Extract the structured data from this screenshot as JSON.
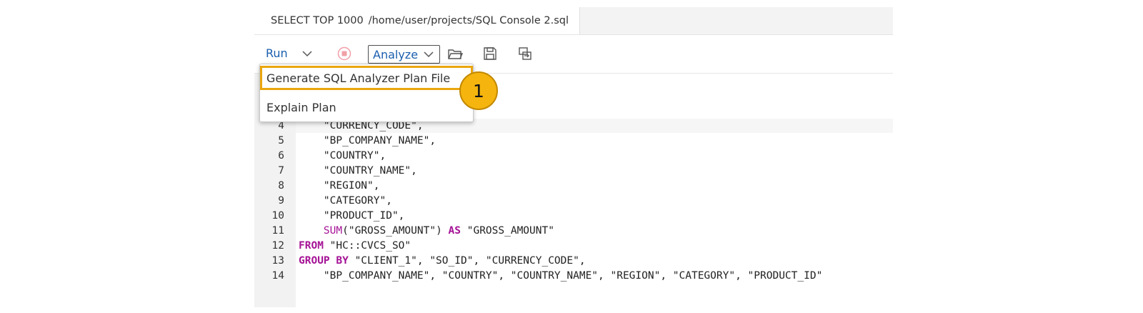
{
  "tab": {
    "title": "SELECT TOP 1000",
    "path": "/home/user/projects/SQL Console 2.sql",
    "icon": "database-icon",
    "unsaved_indicator": "dot"
  },
  "toolbar": {
    "run_label": "Run",
    "analyze_label": "Analyze",
    "icons": [
      "chevron-down-icon",
      "stop-icon",
      "folder-open-icon",
      "save-icon",
      "export-icon"
    ]
  },
  "dropdown": {
    "items": [
      {
        "label": "Generate SQL Analyzer Plan File"
      },
      {
        "label": "Explain Plan"
      }
    ]
  },
  "callout": {
    "label": "1"
  },
  "editor": {
    "lines": [
      {
        "num": "4",
        "text": "    \"CURRENCY_CODE\","
      },
      {
        "num": "5",
        "text": "    \"BP_COMPANY_NAME\","
      },
      {
        "num": "6",
        "text": "    \"COUNTRY\","
      },
      {
        "num": "7",
        "text": "    \"COUNTRY_NAME\","
      },
      {
        "num": "8",
        "text": "    \"REGION\","
      },
      {
        "num": "9",
        "text": "    \"CATEGORY\","
      },
      {
        "num": "10",
        "text": "    \"PRODUCT_ID\","
      },
      {
        "num": "11",
        "indent": "    ",
        "fn": "SUM",
        "rest1": "(\"GROSS_AMOUNT\") ",
        "kw": "AS",
        "rest2": " \"GROSS_AMOUNT\""
      },
      {
        "num": "12",
        "kw": "FROM",
        "rest": " \"HC::CVCS_SO\""
      },
      {
        "num": "13",
        "kw": "GROUP BY",
        "rest": " \"CLIENT_1\", \"SO_ID\", \"CURRENCY_CODE\","
      },
      {
        "num": "14",
        "text": "    \"BP_COMPANY_NAME\", \"COUNTRY\", \"COUNTRY_NAME\", \"REGION\", \"CATEGORY\", \"PRODUCT_ID\""
      }
    ]
  },
  "colors": {
    "accent": "#1a5fae",
    "keyword": "#a51296",
    "highlight": "#eaa60e",
    "callout": "#f5b50e",
    "db_icon": "#e0475b"
  }
}
